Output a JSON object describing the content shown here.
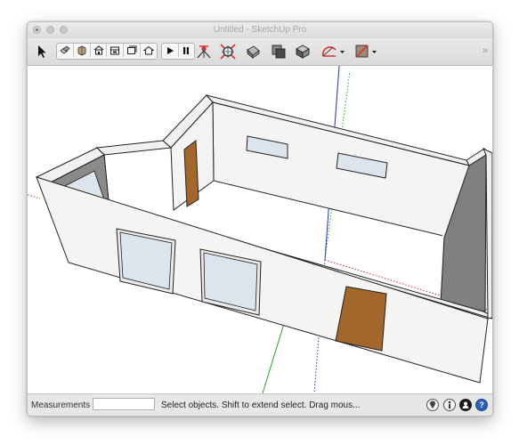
{
  "window": {
    "title": "Untitled - SketchUp Pro"
  },
  "toolbar": {
    "tools": [
      "select-arrow-icon",
      "components-icon",
      "materials-icon",
      "warehouse-icon",
      "extension-warehouse-icon",
      "layout-icon",
      "home-view-icon",
      "play-icon",
      "pause-icon",
      "survey-icon",
      "zoom-extents-icon",
      "section-plane-icon",
      "section-display-icon",
      "section-cut-icon",
      "protractor-icon",
      "position-camera-icon"
    ],
    "overflow_label": "»"
  },
  "status": {
    "measurements_label": "Measurements",
    "measurements_value": "",
    "message": "Select objects. Shift to extend select. Drag mous...",
    "icons": [
      "geo-location-icon",
      "credits-icon",
      "account-icon",
      "help-icon"
    ],
    "help_glyph": "?"
  },
  "colors": {
    "axis_red": "#d22828",
    "axis_green": "#22aa22",
    "axis_blue": "#2233cc",
    "wall_face": "#f3f3f1",
    "wall_shade": "#808080",
    "door": "#a4672b",
    "window_glass": "#dce4ee",
    "help_blue": "#2a5fb7"
  }
}
